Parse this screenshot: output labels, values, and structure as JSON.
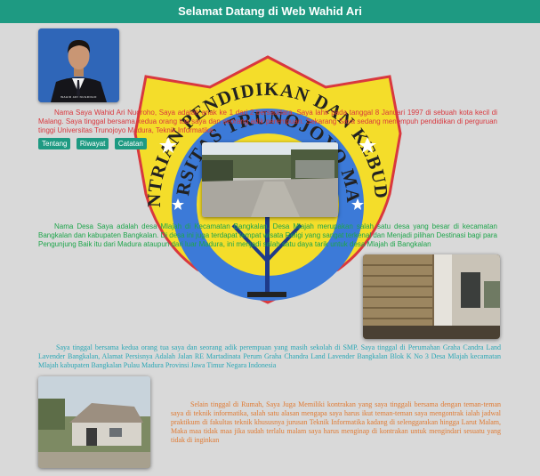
{
  "header": {
    "title": "Selamat Datang di Web Wahid Ari"
  },
  "profile": {
    "photo_caption": "WAHID ARI NUGROHO",
    "intro": "Nama Saya Wahid Ari Nugroho, Saya adalah anak ke 1 dari 2 bersaudara. Saya lahir pada tanggal 8 Januari 1997 di sebuah kota kecil di Malang. Saya tinggal bersama kedua orang tua saya dan seorang adik perempuan. Sekarang Saya sedang menempuh pendidikan di perguruan tinggi Universitas Trunojoyo Madura, Teknik Informatika."
  },
  "tabs": [
    {
      "label": "Tentang"
    },
    {
      "label": "Riwayat"
    },
    {
      "label": "Catatan"
    }
  ],
  "logo": {
    "top_text": "KEMENTRIAN PENDIDIKAN DAN KEBUDAYAAN",
    "inner_text": "UNIVERSITAS TRUNOJOYO MADURA"
  },
  "village": {
    "text": "Nama Desa Saya adalah desa Mlajah di Kecamatan Bangkalan. Desa Mlajah merupakan salah satu desa yang besar di kecamatan Bangkalan dan kabupaten Bangkalan. Di desa ini juga terdapat tempat wisata Religi yang sangat terkenal dan Menjadi pilihan Destinasi bagi para Pengunjung Baik itu dari Madura ataupun dari luar Madura, ini menjadi salah satu daya tarik untuk desa Mlajah di Bangkalan"
  },
  "family": {
    "text": "Saya tinggal bersama kedua orang tua saya dan seorang adik perempuan yang masih sekolah di SMP. Saya tinggal di Perumahan Graha Candra Land Lavender Bangkalan, Alamat Persisnya Adalah Jalan RE Martadinata Perum Graha Chandra Land Lavender Bangkalan Blok K No 3 Desa Mlajah kecamatan Mlajah kabupaten Bangkalan Pulau Madura Provinsi Jawa Timur Negara Indonesia"
  },
  "rumah": {
    "text": "Selain tinggal di Rumah, Saya Juga Memiliki kontrakan yang saya tinggali bersama dengan teman-teman saya di teknik informatika, salah satu alasan mengapa saya harus ikut teman-teman saya mengontrak ialah jadwal praktikum di fakultas teknik khususnya jurusan Teknik Informatika kadang di selenggarakan hingga Larut Malam, Maka maa tidak maa jika sudah terlalu malam saya harus menginap di kontrakan untuk mengindari sesuatu yang tidak di inginkan"
  },
  "colors": {
    "header": "#1e9a82",
    "intro_text": "#d9383e",
    "village_text": "#1ea54b",
    "family_text": "#2aa7b5",
    "rumah_text": "#e07a32",
    "logo_yellow": "#f4dd2a",
    "logo_blue": "#3c7ad8",
    "logo_red": "#d9383e"
  }
}
